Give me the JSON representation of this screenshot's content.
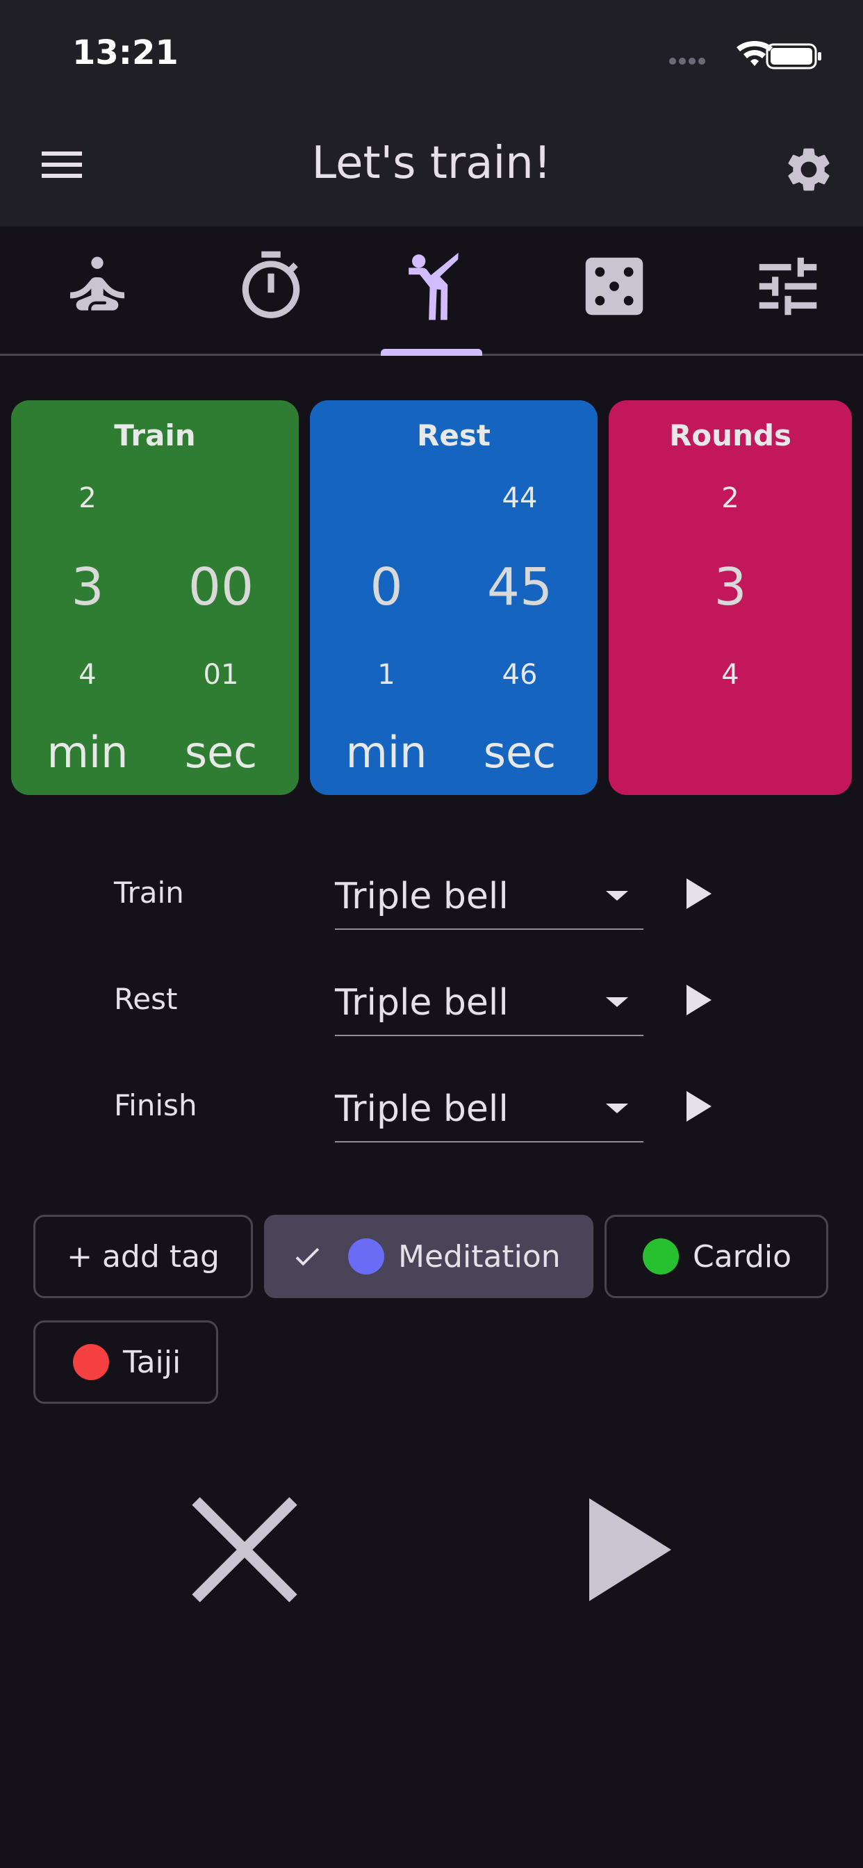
{
  "status": {
    "time": "13:21"
  },
  "app_bar": {
    "title": "Let's train!",
    "menu_icon": "menu-icon",
    "settings_icon": "gear-icon"
  },
  "tabs": [
    {
      "name": "meditation",
      "icon": "meditation-icon",
      "selected": false
    },
    {
      "name": "timer",
      "icon": "stopwatch-icon",
      "selected": false
    },
    {
      "name": "interval-training",
      "icon": "martial-arts-icon",
      "selected": true
    },
    {
      "name": "random",
      "icon": "dice-icon",
      "selected": false
    },
    {
      "name": "presets",
      "icon": "sliders-icon",
      "selected": false
    }
  ],
  "cards": {
    "train": {
      "title": "Train",
      "color": "#2e7d32",
      "min": {
        "prev": "2",
        "value": "3",
        "next": "4",
        "unit": "min"
      },
      "sec": {
        "prev": "",
        "value": "00",
        "next": "01",
        "unit": "sec"
      }
    },
    "rest": {
      "title": "Rest",
      "color": "#1565c0",
      "min": {
        "prev": "",
        "value": "0",
        "next": "1",
        "unit": "min"
      },
      "sec": {
        "prev": "44",
        "value": "45",
        "next": "46",
        "unit": "sec"
      }
    },
    "rounds": {
      "title": "Rounds",
      "color": "#c2185b",
      "prev": "2",
      "value": "3",
      "next": "4"
    }
  },
  "sounds": [
    {
      "label": "Train",
      "value": "Triple bell"
    },
    {
      "label": "Rest",
      "value": "Triple bell"
    },
    {
      "label": "Finish",
      "value": "Triple bell"
    }
  ],
  "tags": {
    "add_label": "+ add tag",
    "items": [
      {
        "label": "Meditation",
        "color": "#6b6cf6",
        "selected": true
      },
      {
        "label": "Cardio",
        "color": "#27c12f",
        "selected": false
      },
      {
        "label": "Taiji",
        "color": "#f44040",
        "selected": false
      }
    ]
  },
  "controls": {
    "cancel_icon": "close-icon",
    "start_icon": "play-icon"
  }
}
